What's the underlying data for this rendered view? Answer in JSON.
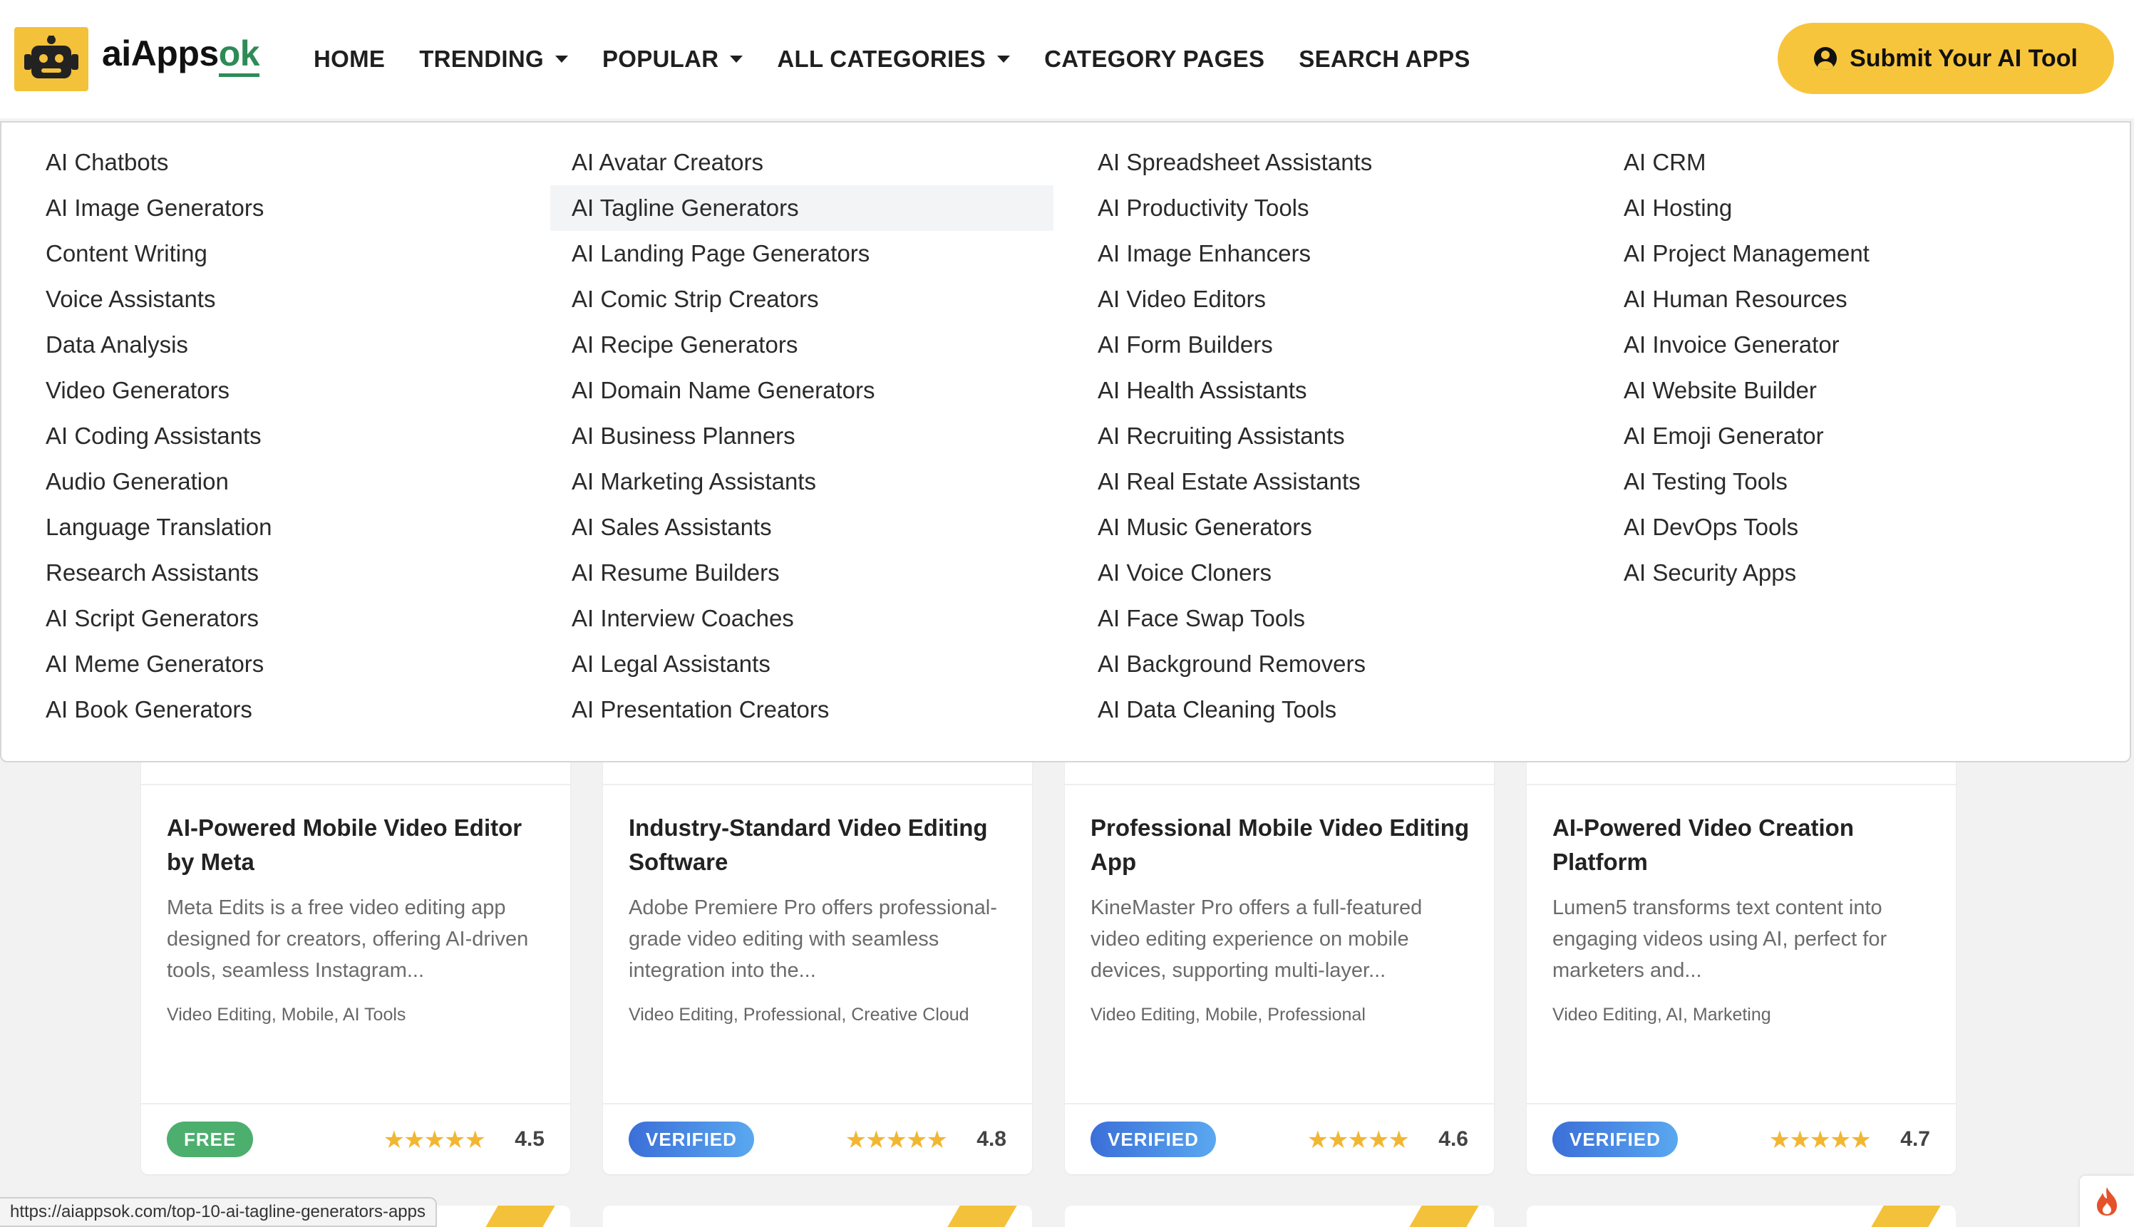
{
  "brand": {
    "name_prefix": "aiApps",
    "name_suffix": "ok",
    "accent": "#f3c13a",
    "green": "#2e8b57"
  },
  "nav": {
    "home": "HOME",
    "trending": "TRENDING",
    "popular": "POPULAR",
    "all_categories": "ALL CATEGORIES",
    "category_pages": "CATEGORY PAGES",
    "search_apps": "SEARCH APPS"
  },
  "submit_button": "Submit Your AI Tool",
  "mega_menu": {
    "columns": [
      [
        "AI Chatbots",
        "AI Image Generators",
        "Content Writing",
        "Voice Assistants",
        "Data Analysis",
        "Video Generators",
        "AI Coding Assistants",
        "Audio Generation",
        "Language Translation",
        "Research Assistants",
        "AI Script Generators",
        "AI Meme Generators",
        "AI Book Generators"
      ],
      [
        "AI Avatar Creators",
        "AI Tagline Generators",
        "AI Landing Page Generators",
        "AI Comic Strip Creators",
        "AI Recipe Generators",
        "AI Domain Name Generators",
        "AI Business Planners",
        "AI Marketing Assistants",
        "AI Sales Assistants",
        "AI Resume Builders",
        "AI Interview Coaches",
        "AI Legal Assistants",
        "AI Presentation Creators"
      ],
      [
        "AI Spreadsheet Assistants",
        "AI Productivity Tools",
        "AI Image Enhancers",
        "AI Video Editors",
        "AI Form Builders",
        "AI Health Assistants",
        "AI Recruiting Assistants",
        "AI Real Estate Assistants",
        "AI Music Generators",
        "AI Voice Cloners",
        "AI Face Swap Tools",
        "AI Background Removers",
        "AI Data Cleaning Tools"
      ],
      [
        "AI CRM",
        "AI Hosting",
        "AI Project Management",
        "AI Human Resources",
        "AI Invoice Generator",
        "AI Website Builder",
        "AI Emoji Generator",
        "AI Testing Tools",
        "AI DevOps Tools",
        "AI Security Apps"
      ]
    ],
    "hovered_item": "AI Tagline Generators"
  },
  "cards": [
    {
      "title": "AI-Powered Mobile Video Editor by Meta",
      "desc": "Meta Edits is a free video editing app designed for creators, offering AI-driven tools, seamless Instagram...",
      "tags": "Video Editing, Mobile, AI Tools",
      "badge": "FREE",
      "stars": "★★★★★",
      "rating": "4.5"
    },
    {
      "title": "Industry-Standard Video Editing Software",
      "desc": "Adobe Premiere Pro offers professional-grade video editing with seamless integration into the...",
      "tags": "Video Editing, Professional, Creative Cloud",
      "badge": "VERIFIED",
      "stars": "★★★★★",
      "rating": "4.8"
    },
    {
      "title": "Professional Mobile Video Editing App",
      "desc": "KineMaster Pro offers a full-featured video editing experience on mobile devices, supporting multi-layer...",
      "tags": "Video Editing, Mobile, Professional",
      "badge": "VERIFIED",
      "stars": "★★★★★",
      "rating": "4.6"
    },
    {
      "title": "AI-Powered Video Creation Platform",
      "desc": "Lumen5 transforms text content into engaging videos using AI, perfect for marketers and...",
      "tags": "Video Editing, AI, Marketing",
      "badge": "VERIFIED",
      "stars": "★★★★★",
      "rating": "4.7"
    }
  ],
  "status_url": "https://aiappsok.com/top-10-ai-tagline-generators-apps"
}
